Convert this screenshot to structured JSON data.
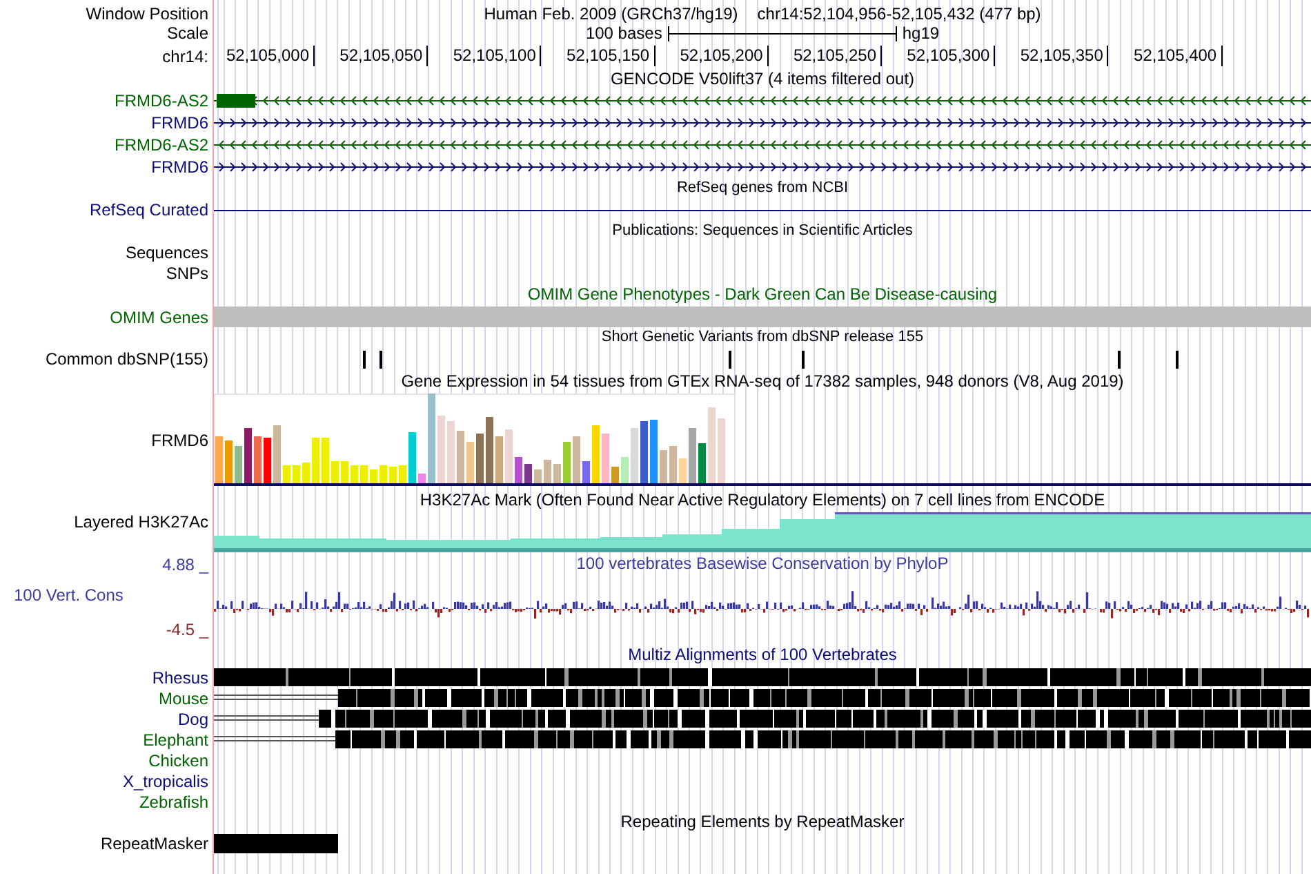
{
  "header": {
    "window_position_label": "Window Position",
    "assembly": "Human Feb. 2009 (GRCh37/hg19)",
    "position": "chr14:52,104,956-52,105,432 (477 bp)",
    "scale_label": "Scale",
    "scale_text": "100 bases",
    "scale_db": "hg19",
    "chrom_label": "chr14:",
    "ruler_ticks": [
      "52,105,000",
      "52,105,050",
      "52,105,100",
      "52,105,150",
      "52,105,200",
      "52,105,250",
      "52,105,300",
      "52,105,350",
      "52,105,400"
    ]
  },
  "tracks": [
    {
      "kind": "genes",
      "title": "GENCODE V50lift37 (4 items filtered out)",
      "items": [
        {
          "name": "FRMD6-AS2",
          "reverse_strand": true,
          "color": "#006400",
          "exon": true
        },
        {
          "name": "FRMD6",
          "reverse_strand": false,
          "color": "#0c0c78",
          "exon": false
        },
        {
          "name": "FRMD6-AS2",
          "reverse_strand": true,
          "color": "#006400",
          "exon": false
        },
        {
          "name": "FRMD6",
          "reverse_strand": false,
          "color": "#0c0c78",
          "exon": false
        }
      ]
    },
    {
      "kind": "line",
      "title": "RefSeq genes from NCBI",
      "label": "RefSeq Curated",
      "color": "#0c0c78"
    },
    {
      "kind": "empty",
      "title": "Publications: Sequences in Scientific Articles",
      "labels": [
        "Sequences",
        "SNPs"
      ]
    },
    {
      "kind": "omim",
      "title": "OMIM Gene Phenotypes - Dark Green Can Be Disease-causing",
      "label": "OMIM Genes",
      "color": "#006400"
    },
    {
      "kind": "snps",
      "title": "Short Genetic Variants from dbSNP release 155",
      "label": "Common dbSNP(155)"
    },
    {
      "kind": "expression",
      "title": "Gene Expression in 54 tissues from GTEx RNA-seq of 17382 samples, 948 donors (V8, Aug 2019)",
      "label": "FRMD6"
    },
    {
      "kind": "layered",
      "title": "H3K27Ac Mark (Often Found Near Active Regulatory Elements) on 7 cell lines from ENCODE",
      "label": "Layered H3K27Ac"
    },
    {
      "kind": "conservation",
      "title": "100 vertebrates Basewise Conservation by PhyloP",
      "label": "100 Vert. Cons",
      "color": "#3c3c9c",
      "axis_max": "4.88 _",
      "axis_min": "-4.5 _"
    },
    {
      "kind": "alignment",
      "title": "Multiz Alignments of 100 Vertebrates",
      "color": "#0c0c78",
      "species": [
        {
          "name": "Rhesus",
          "color": "#0c0c78",
          "aligned": true
        },
        {
          "name": "Mouse",
          "color": "#006400",
          "aligned": true
        },
        {
          "name": "Dog",
          "color": "#0c0c78",
          "aligned": true
        },
        {
          "name": "Elephant",
          "color": "#006400",
          "aligned": true
        },
        {
          "name": "Chicken",
          "color": "#006400",
          "aligned": false
        },
        {
          "name": "X_tropicalis",
          "color": "#0c0c78",
          "aligned": false
        },
        {
          "name": "Zebrafish",
          "color": "#006400",
          "aligned": false
        }
      ]
    },
    {
      "kind": "repeats",
      "title": "Repeating Elements by RepeatMasker",
      "label": "RepeatMasker"
    }
  ]
}
